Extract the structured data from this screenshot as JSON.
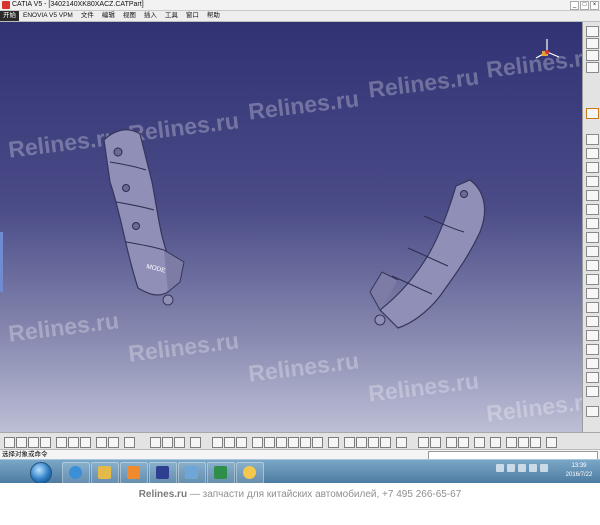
{
  "window": {
    "title": "CATIA V5 - [3402140XK80XACZ.CATPart]",
    "buttons": [
      "_",
      "□",
      "×"
    ]
  },
  "menubar": {
    "items": [
      "开始",
      "ENOVIA V5 VPM",
      "文件",
      "编辑",
      "视图",
      "插入",
      "工具",
      "窗口",
      "帮助"
    ]
  },
  "viewport": {
    "watermark": "Relines.ru",
    "part_labels": [
      "MODE"
    ]
  },
  "statusbar": {
    "text": "选择对象或命令"
  },
  "taskbar": {
    "apps": [
      "ie",
      "folder",
      "media-player",
      "catia",
      "images",
      "excel",
      "weather"
    ],
    "clock_time": "13:39",
    "clock_date": "2016/7/22"
  },
  "footer": {
    "brand": "Relines.ru",
    "tagline": " — запчасти для китайских автомобилей, +7 495 266-65-67"
  },
  "colors": {
    "viewport_top": "#313274",
    "viewport_bottom": "#bdbfd6",
    "part": "#8f8fb8"
  }
}
